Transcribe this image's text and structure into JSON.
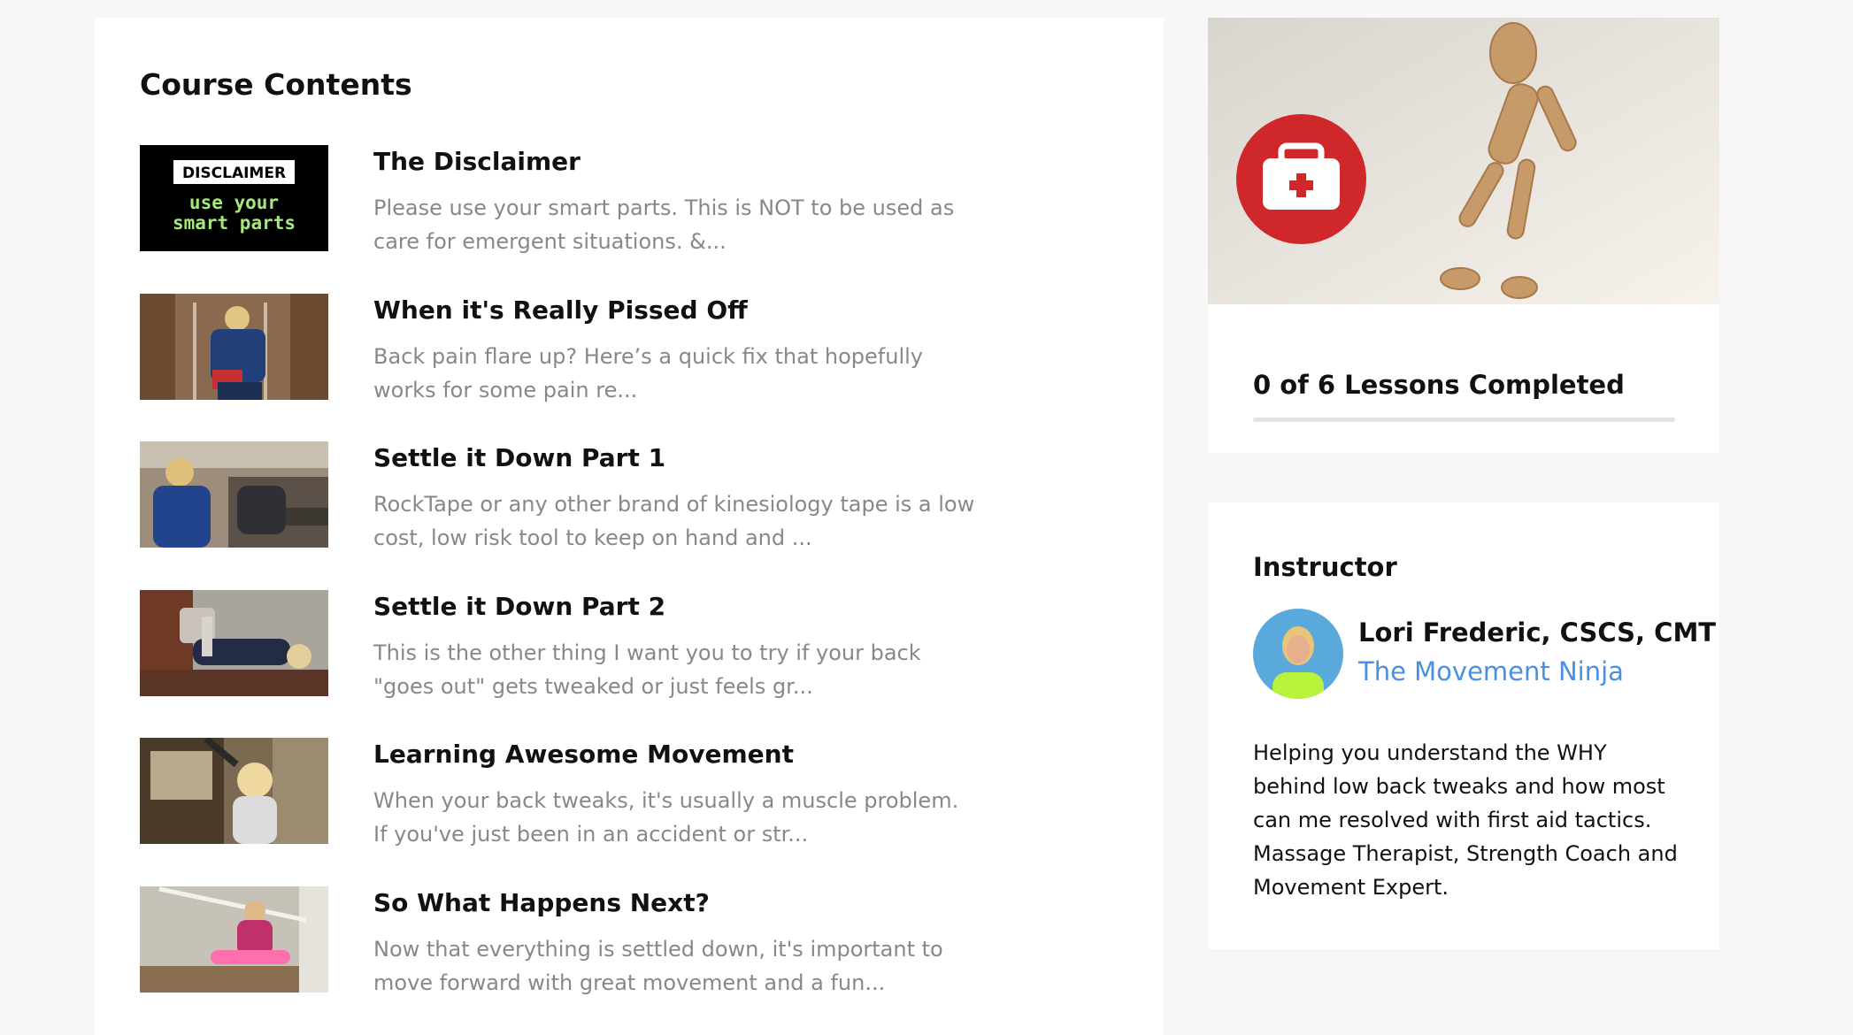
{
  "course": {
    "heading": "Course Contents",
    "lessons": [
      {
        "title": "The Disclaimer",
        "description": " Please use your smart parts. This is NOT to be used as care for emergent situations. &...",
        "thumbnail": "disclaimer-card"
      },
      {
        "title": "When it's Really Pissed Off",
        "description": "  Back pain flare up?  Here’s a quick fix that hopefully works for some pain re...",
        "thumbnail": "video-still"
      },
      {
        "title": "Settle it Down Part 1",
        "description": "RockTape or any other brand of kinesiology tape is a low cost, low risk tool to keep on hand and ...",
        "thumbnail": "video-still"
      },
      {
        "title": "Settle it Down Part 2",
        "description": "This is the other thing I want you to try if your back \"goes out\" gets tweaked or just feels gr...",
        "thumbnail": "video-still"
      },
      {
        "title": "Learning Awesome Movement",
        "description": "When your back tweaks, it's usually a muscle problem. If you've just been in an accident or str...",
        "thumbnail": "video-still"
      },
      {
        "title": "So What Happens Next?",
        "description": "Now that everything is settled down, it's important to move forward with great movement and a fun...",
        "thumbnail": "video-still"
      }
    ],
    "disclaimer_thumb": {
      "line1": "DISCLAIMER",
      "line2": "use your",
      "line3": "smart parts"
    }
  },
  "progress": {
    "text": "0 of 6 Lessons Completed",
    "completed": 0,
    "total": 6,
    "hero_icon": "first-aid-kit-icon"
  },
  "instructor": {
    "heading": "Instructor",
    "name": "Lori Frederic, CSCS, CMT",
    "link": "The Movement Ninja",
    "bio": "Helping you understand the WHY behind low back tweaks and how most can me resolved with first aid tactics. Massage Therapist, Strength Coach and Movement Expert."
  },
  "colors": {
    "accent": "#4a90e2",
    "badge_red": "#d0282a",
    "thumb_green": "#a4e87a"
  }
}
